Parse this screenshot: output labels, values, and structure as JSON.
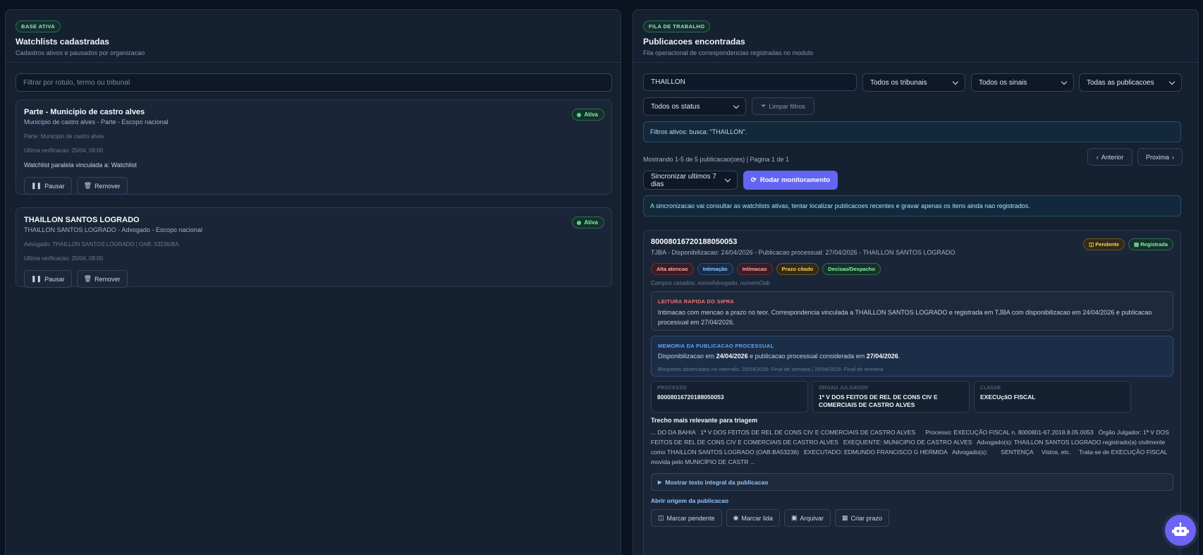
{
  "left": {
    "badge": "BASE ATIVA",
    "title": "Watchlists cadastradas",
    "subtitle": "Cadastros ativos e pausados por organizacao",
    "filter_placeholder": "Filtrar por rotulo, termo ou tribunal",
    "watchlists": [
      {
        "title": "Parte - Municipio de castro alves",
        "subtitle": "Municipio de castro alves - Parte - Escopo nacional",
        "meta": "Parte: Municipio de castro alves",
        "verified": "Ultima verificacao: 25/04, 08:00",
        "note": "Watchlist paralela vinculada a: Watchlist",
        "status": "Ativa",
        "pause_label": "Pausar",
        "remove_label": "Remover"
      },
      {
        "title": "THAILLON SANTOS LOGRADO",
        "subtitle": "THAILLON SANTOS LOGRADO - Advogado - Escopo nacional",
        "meta": "Advogado: THAILLON SANTOS LOGRADO | OAB: 53236/BA",
        "verified": "Ultima verificacao: 25/04, 08:00",
        "status": "Ativa",
        "pause_label": "Pausar",
        "remove_label": "Remover"
      }
    ]
  },
  "right": {
    "badge": "FILA DE TRABALHO",
    "title": "Publicacoes encontradas",
    "subtitle": "Fila operacional de correspondencias registradas no modulo",
    "search_value": "THAILLON",
    "filters": {
      "tribunais": "Todos os tribunais",
      "sinais": "Todos os sinais",
      "publicacoes": "Todas as publicacoes",
      "status": "Todos os status",
      "clear": "Limpar filtros"
    },
    "active_filters": "Filtros ativos: busca: \"THAILLON\".",
    "showing": "Mostrando 1-5 de 5 publicacao(oes) | Pagina 1 de 1",
    "prev": "Anterior",
    "next": "Proxima",
    "sync_select": "Sincronizar ultimos 7 dias",
    "run_button": "Rodar monitoramento",
    "sync_info": "A sincronizacao vai consultar as watchlists ativas, tentar localizar publicacoes recentes e gravar apenas os itens ainda nao registrados.",
    "publication": {
      "number": "80008016720188050053",
      "details": "TJBA - Disponibilizacao: 24/04/2026 - Publicacao processual: 27/04/2026 - THAILLON SANTOS LOGRADO",
      "status_pendente": "Pendente",
      "status_registrada": "Registrada",
      "tags": [
        "Alta atencao",
        "Intimação",
        "Intimacao",
        "Prazo citado",
        "Decisao/Despacho"
      ],
      "matched": "Campos casados: nomeAdvogado, numeroOab",
      "quick_title": "LEITURA RAPIDA DO SIPRA",
      "quick_text": "Intimacao com mencao a prazo no teor. Correspondencia vinculada a THAILLON SANTOS LOGRADO e registrada em TJBA com disponibilizacao em 24/04/2026 e publicacao processual em 27/04/2026.",
      "memory_title": "MEMORIA DA PUBLICACAO PROCESSUAL",
      "memory_pre": "Disponibilizacao em",
      "memory_date1": "24/04/2026",
      "memory_mid": "e publicacao processual considerada em",
      "memory_date2": "27/04/2026",
      "memory_end": ".",
      "memory_blocks": "Bloqueios observados no intervalo: 25/04/2026: Final de semana | 26/04/2026: Final de semana",
      "processo_label": "PROCESSO",
      "processo_value": "80008016720188050053",
      "orgao_label": "ORGAO JULGADOR",
      "orgao_value": "1ª V DOS FEITOS DE REL DE CONS CIV E COMERCIAIS DE CASTRO ALVES",
      "classe_label": "CLASSE",
      "classe_value": "EXECUçãO FISCAL",
      "excerpt_title": "Trecho mais relevante para triagem",
      "excerpt": "... DO DA BAHIA   1ª V DOS FEITOS DE REL DE CONS CIV E COMERCIAIS DE CASTRO ALVES      Processo: EXECUÇÃO FISCAL n. 8000801-67.2018.8.05.0053   Órgão Julgador: 1ª V DOS FEITOS DE REL DE CONS CIV E COMERCIAIS DE CASTRO ALVES   EXEQUENTE: MUNICIPIO DE CASTRO ALVES   Advogado(s): THAILLON SANTOS LOGRADO registrado(a) civilmente como THAILLON SANTOS LOGRADO (OAB:BA53236)   EXECUTADO: EDMUNDO FRANCISCO G HERMIDA   Advogado(s):        SENTENÇA     Vistos, etc.     Trata-se de EXECUÇÃO FISCAL movida pelo MUNICÍPIO DE CASTR ...",
      "show_full": "Mostrar texto integral da publicacao",
      "open_origin": "Abrir origem da publicacao",
      "actions": {
        "pending": "Marcar pendente",
        "read": "Marcar lida",
        "archive": "Arquivar",
        "deadline": "Criar prazo"
      }
    }
  }
}
